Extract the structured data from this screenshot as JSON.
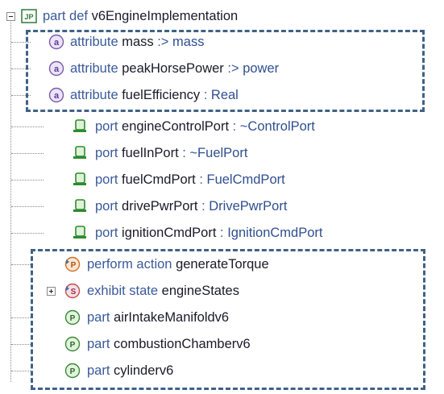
{
  "root": {
    "keyword": "part def",
    "name": "v6EngineImplementation",
    "icon": "part-def-icon",
    "icon_text": "JP"
  },
  "attributes": [
    {
      "keyword": "attribute",
      "name": "mass",
      "sep": " :>",
      "type": "mass"
    },
    {
      "keyword": "attribute",
      "name": "peakHorsePower",
      "sep": " :>",
      "type": "power"
    },
    {
      "keyword": "attribute",
      "name": "fuelEfficiency",
      "sep": " :",
      "type": "Real"
    }
  ],
  "ports": [
    {
      "keyword": "port",
      "name": "engineControlPort",
      "sep": " :",
      "type": "~ControlPort"
    },
    {
      "keyword": "port",
      "name": "fuelInPort",
      "sep": " :",
      "type": "~FuelPort"
    },
    {
      "keyword": "port",
      "name": "fuelCmdPort",
      "sep": " :",
      "type": "FuelCmdPort"
    },
    {
      "keyword": "port",
      "name": "drivePwrPort",
      "sep": " :",
      "type": "DrivePwrPort"
    },
    {
      "keyword": "port",
      "name": "ignitionCmdPort",
      "sep": " :",
      "type": "IgnitionCmdPort"
    }
  ],
  "actions": [
    {
      "keyword": "perform action",
      "name": "generateTorque",
      "icon_text": "P"
    },
    {
      "keyword": "exhibit state",
      "name": "engineStates",
      "icon_text": "S"
    }
  ],
  "parts": [
    {
      "keyword": "part",
      "name": "airIntakeManifoldv6",
      "icon_text": "P"
    },
    {
      "keyword": "part",
      "name": "combustionChamberv6",
      "icon_text": "P"
    },
    {
      "keyword": "part",
      "name": "cylinderv6",
      "icon_text": "P"
    }
  ],
  "colors": {
    "attribute_icon": "#7b5bb0",
    "port_icon": "#2f8a2f",
    "action_icon": "#d0702a",
    "state_icon": "#c0504d",
    "part_icon": "#3a8a3a",
    "dash_box": "#3f6287"
  }
}
